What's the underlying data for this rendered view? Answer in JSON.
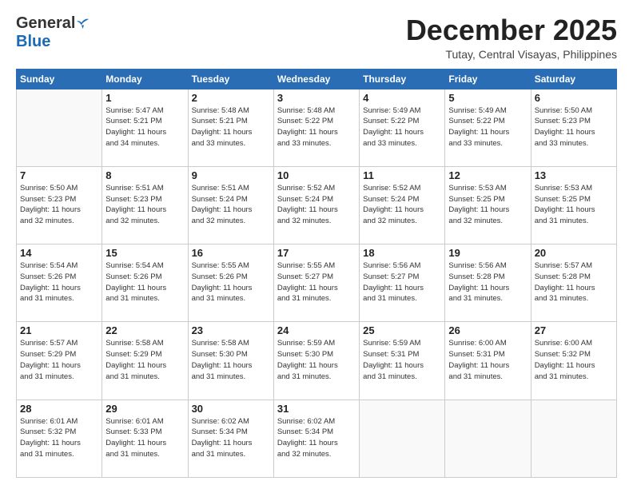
{
  "header": {
    "logo_general": "General",
    "logo_blue": "Blue",
    "month_title": "December 2025",
    "location": "Tutay, Central Visayas, Philippines"
  },
  "weekdays": [
    "Sunday",
    "Monday",
    "Tuesday",
    "Wednesday",
    "Thursday",
    "Friday",
    "Saturday"
  ],
  "weeks": [
    [
      {
        "day": "",
        "info": ""
      },
      {
        "day": "1",
        "info": "Sunrise: 5:47 AM\nSunset: 5:21 PM\nDaylight: 11 hours\nand 34 minutes."
      },
      {
        "day": "2",
        "info": "Sunrise: 5:48 AM\nSunset: 5:21 PM\nDaylight: 11 hours\nand 33 minutes."
      },
      {
        "day": "3",
        "info": "Sunrise: 5:48 AM\nSunset: 5:22 PM\nDaylight: 11 hours\nand 33 minutes."
      },
      {
        "day": "4",
        "info": "Sunrise: 5:49 AM\nSunset: 5:22 PM\nDaylight: 11 hours\nand 33 minutes."
      },
      {
        "day": "5",
        "info": "Sunrise: 5:49 AM\nSunset: 5:22 PM\nDaylight: 11 hours\nand 33 minutes."
      },
      {
        "day": "6",
        "info": "Sunrise: 5:50 AM\nSunset: 5:23 PM\nDaylight: 11 hours\nand 33 minutes."
      }
    ],
    [
      {
        "day": "7",
        "info": "Sunrise: 5:50 AM\nSunset: 5:23 PM\nDaylight: 11 hours\nand 32 minutes."
      },
      {
        "day": "8",
        "info": "Sunrise: 5:51 AM\nSunset: 5:23 PM\nDaylight: 11 hours\nand 32 minutes."
      },
      {
        "day": "9",
        "info": "Sunrise: 5:51 AM\nSunset: 5:24 PM\nDaylight: 11 hours\nand 32 minutes."
      },
      {
        "day": "10",
        "info": "Sunrise: 5:52 AM\nSunset: 5:24 PM\nDaylight: 11 hours\nand 32 minutes."
      },
      {
        "day": "11",
        "info": "Sunrise: 5:52 AM\nSunset: 5:24 PM\nDaylight: 11 hours\nand 32 minutes."
      },
      {
        "day": "12",
        "info": "Sunrise: 5:53 AM\nSunset: 5:25 PM\nDaylight: 11 hours\nand 32 minutes."
      },
      {
        "day": "13",
        "info": "Sunrise: 5:53 AM\nSunset: 5:25 PM\nDaylight: 11 hours\nand 31 minutes."
      }
    ],
    [
      {
        "day": "14",
        "info": "Sunrise: 5:54 AM\nSunset: 5:26 PM\nDaylight: 11 hours\nand 31 minutes."
      },
      {
        "day": "15",
        "info": "Sunrise: 5:54 AM\nSunset: 5:26 PM\nDaylight: 11 hours\nand 31 minutes."
      },
      {
        "day": "16",
        "info": "Sunrise: 5:55 AM\nSunset: 5:26 PM\nDaylight: 11 hours\nand 31 minutes."
      },
      {
        "day": "17",
        "info": "Sunrise: 5:55 AM\nSunset: 5:27 PM\nDaylight: 11 hours\nand 31 minutes."
      },
      {
        "day": "18",
        "info": "Sunrise: 5:56 AM\nSunset: 5:27 PM\nDaylight: 11 hours\nand 31 minutes."
      },
      {
        "day": "19",
        "info": "Sunrise: 5:56 AM\nSunset: 5:28 PM\nDaylight: 11 hours\nand 31 minutes."
      },
      {
        "day": "20",
        "info": "Sunrise: 5:57 AM\nSunset: 5:28 PM\nDaylight: 11 hours\nand 31 minutes."
      }
    ],
    [
      {
        "day": "21",
        "info": "Sunrise: 5:57 AM\nSunset: 5:29 PM\nDaylight: 11 hours\nand 31 minutes."
      },
      {
        "day": "22",
        "info": "Sunrise: 5:58 AM\nSunset: 5:29 PM\nDaylight: 11 hours\nand 31 minutes."
      },
      {
        "day": "23",
        "info": "Sunrise: 5:58 AM\nSunset: 5:30 PM\nDaylight: 11 hours\nand 31 minutes."
      },
      {
        "day": "24",
        "info": "Sunrise: 5:59 AM\nSunset: 5:30 PM\nDaylight: 11 hours\nand 31 minutes."
      },
      {
        "day": "25",
        "info": "Sunrise: 5:59 AM\nSunset: 5:31 PM\nDaylight: 11 hours\nand 31 minutes."
      },
      {
        "day": "26",
        "info": "Sunrise: 6:00 AM\nSunset: 5:31 PM\nDaylight: 11 hours\nand 31 minutes."
      },
      {
        "day": "27",
        "info": "Sunrise: 6:00 AM\nSunset: 5:32 PM\nDaylight: 11 hours\nand 31 minutes."
      }
    ],
    [
      {
        "day": "28",
        "info": "Sunrise: 6:01 AM\nSunset: 5:32 PM\nDaylight: 11 hours\nand 31 minutes."
      },
      {
        "day": "29",
        "info": "Sunrise: 6:01 AM\nSunset: 5:33 PM\nDaylight: 11 hours\nand 31 minutes."
      },
      {
        "day": "30",
        "info": "Sunrise: 6:02 AM\nSunset: 5:34 PM\nDaylight: 11 hours\nand 31 minutes."
      },
      {
        "day": "31",
        "info": "Sunrise: 6:02 AM\nSunset: 5:34 PM\nDaylight: 11 hours\nand 32 minutes."
      },
      {
        "day": "",
        "info": ""
      },
      {
        "day": "",
        "info": ""
      },
      {
        "day": "",
        "info": ""
      }
    ]
  ]
}
